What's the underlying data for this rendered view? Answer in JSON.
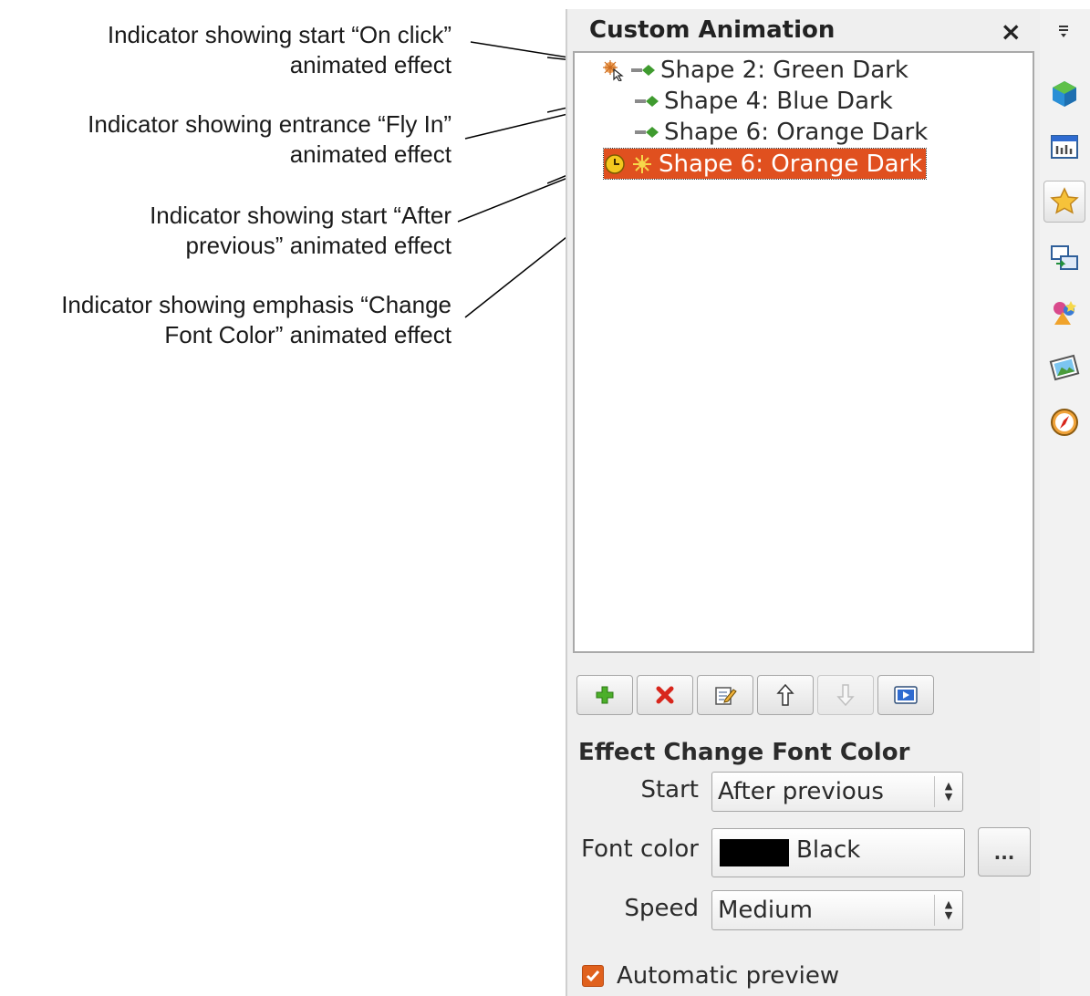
{
  "callouts": [
    [
      "Indicator showing start “On click”",
      "animated effect"
    ],
    [
      "Indicator showing entrance “Fly In”",
      "animated effect"
    ],
    [
      "Indicator showing start “After",
      "previous” animated effect"
    ],
    [
      "Indicator showing emphasis “Change",
      "Font Color” animated effect"
    ]
  ],
  "panel": {
    "title": "Custom Animation",
    "close_label": "×"
  },
  "animation_list": [
    {
      "label": "Shape 2: Green Dark",
      "start": "on-click",
      "effect": "entrance",
      "selected": false
    },
    {
      "label": "Shape 4: Blue Dark",
      "start": "with-previous",
      "effect": "entrance",
      "selected": false
    },
    {
      "label": "Shape 6: Orange Dark",
      "start": "with-previous",
      "effect": "entrance",
      "selected": false
    },
    {
      "label": "Shape 6: Orange Dark",
      "start": "after-previous",
      "effect": "emphasis",
      "selected": true
    }
  ],
  "toolbar": {
    "buttons": [
      "add",
      "remove",
      "edit",
      "move-up",
      "move-down",
      "play"
    ],
    "disabled": [
      "move-down"
    ]
  },
  "effect": {
    "title": "Effect Change Font Color",
    "start_label": "Start",
    "start_value": "After previous",
    "font_color_label": "Font color",
    "font_color_value": "Black",
    "font_color_hex": "#000000",
    "more_button": "...",
    "speed_label": "Speed",
    "speed_value": "Medium"
  },
  "automatic_preview": {
    "label": "Automatic preview",
    "checked": true
  },
  "sidebar": {
    "icons": [
      "properties",
      "master-slides",
      "custom-animation",
      "slide-transition",
      "styles",
      "gallery",
      "navigator"
    ],
    "active": "custom-animation"
  },
  "colors": {
    "selection": "#e0501f",
    "checkbox": "#e0611d"
  }
}
